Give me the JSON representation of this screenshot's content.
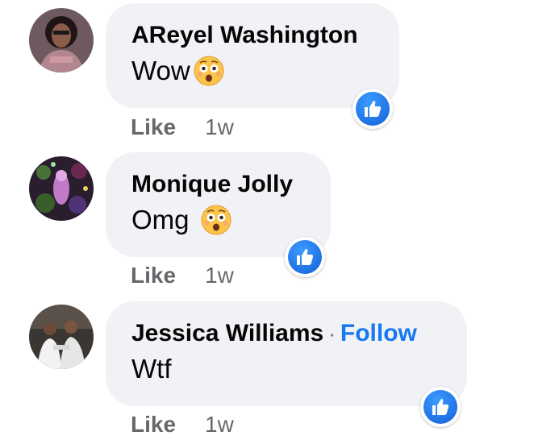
{
  "comments": [
    {
      "author": "AReyel Washington",
      "text": "Wow",
      "emoji": "astonished-face-emoji",
      "like_label": "Like",
      "time": "1w",
      "reaction": "like-reaction"
    },
    {
      "author": "Monique Jolly",
      "text": "Omg",
      "emoji": "astonished-face-emoji",
      "like_label": "Like",
      "time": "1w",
      "reaction": "like-reaction"
    },
    {
      "author": "Jessica Williams",
      "separator": "·",
      "follow_label": "Follow",
      "text": "Wtf",
      "like_label": "Like",
      "time": "1w",
      "reaction": "like-reaction"
    }
  ],
  "colors": {
    "bubble": "#f0f2f5",
    "link": "#1877f2",
    "secondary_text": "#65676b",
    "like_blue": "#1877f2"
  }
}
